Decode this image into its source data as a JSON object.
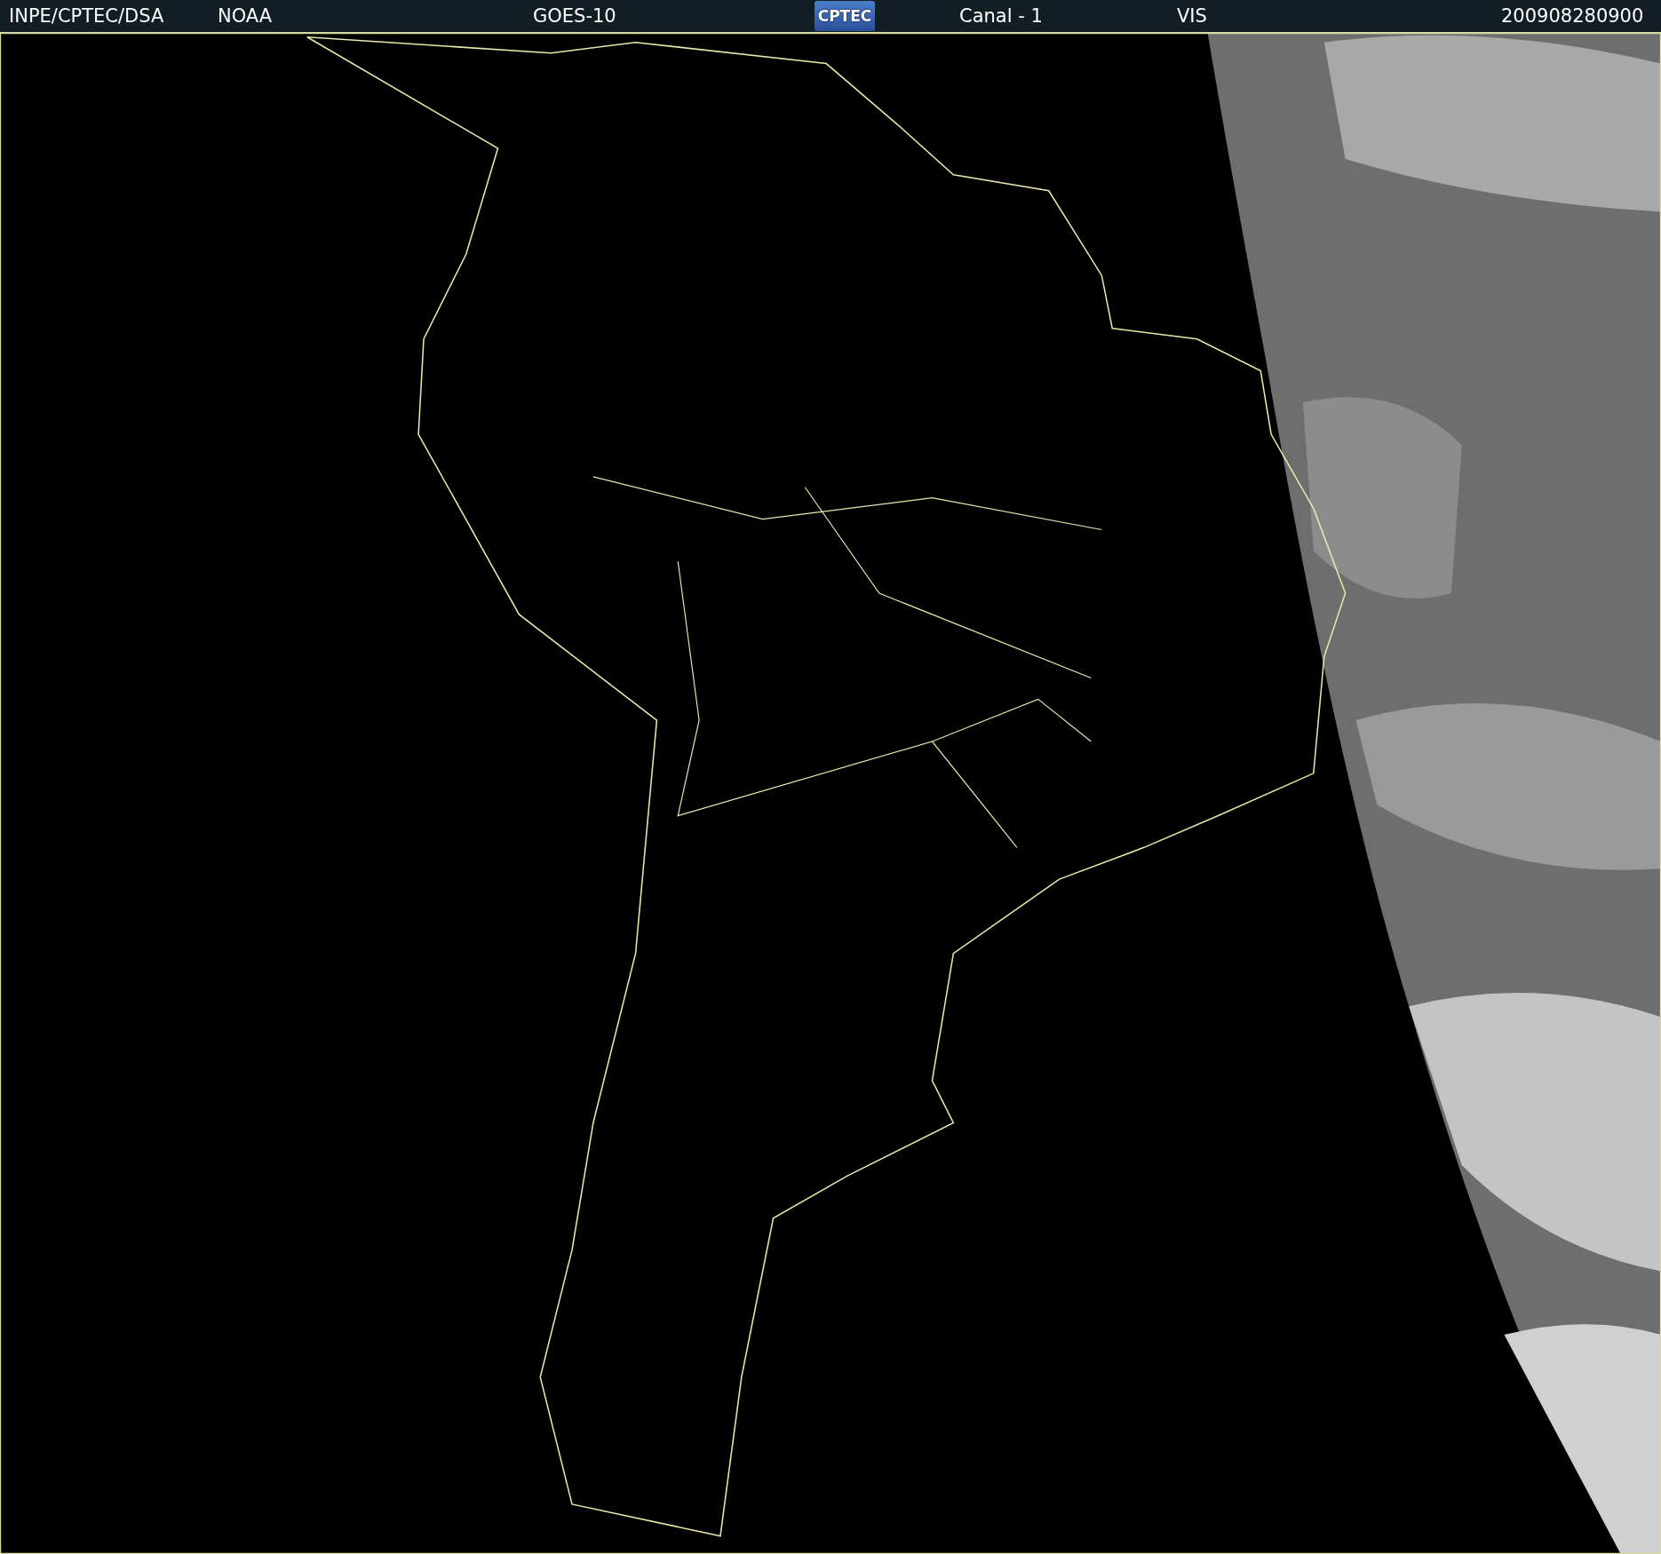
{
  "header": {
    "items": [
      {
        "text": "INPE/CPTEC/DSA"
      },
      {
        "text": "NOAA"
      },
      {
        "text": "GOES-10"
      },
      {
        "text": "CPTEC",
        "kind": "logo"
      },
      {
        "text": "Canal - 1"
      },
      {
        "text": "VIS"
      },
      {
        "text": "200908280900"
      }
    ]
  }
}
